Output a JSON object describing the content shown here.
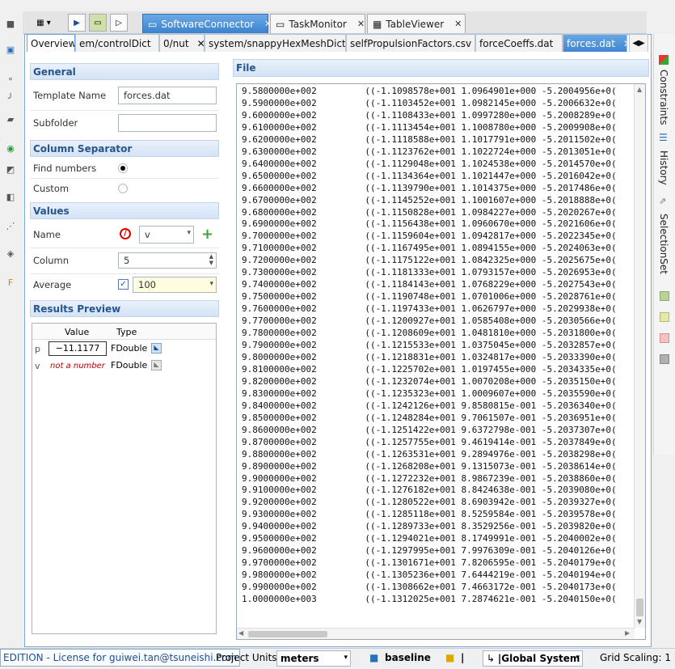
{
  "top_tabs": [
    {
      "label": "SoftwareConnector",
      "active": true
    },
    {
      "label": "TaskMonitor",
      "active": false
    },
    {
      "label": "TableViewer",
      "active": false
    }
  ],
  "doc_tabs": [
    {
      "label": "Overview",
      "state": "selected"
    },
    {
      "label": "em/controlDict",
      "state": "normal"
    },
    {
      "label": "0/nut",
      "state": "normal"
    },
    {
      "label": "system/snappyHexMeshDict",
      "state": "normal"
    },
    {
      "label": "selfPropulsionFactors.csv",
      "state": "normal"
    },
    {
      "label": "forceCoeffs.dat",
      "state": "normal"
    },
    {
      "label": "forces.dat",
      "state": "active"
    }
  ],
  "general": {
    "header": "General",
    "template_label": "Template Name",
    "template_value": "forces.dat",
    "subfolder_label": "Subfolder",
    "subfolder_value": ""
  },
  "column_separator": {
    "header": "Column Separator",
    "find_numbers_label": "Find numbers",
    "custom_label": "Custom",
    "selected": "find_numbers"
  },
  "values": {
    "header": "Values",
    "name_label": "Name",
    "name_value": "v",
    "column_label": "Column",
    "column_value": "5",
    "average_label": "Average",
    "average_checked": true,
    "average_value": "100"
  },
  "results_preview": {
    "header": "Results Preview",
    "col_value": "Value",
    "col_type": "Type",
    "rows": [
      {
        "name": "p",
        "value": "−11.1177",
        "type": "FDouble",
        "value_style": "normal"
      },
      {
        "name": "v",
        "value": "not a number",
        "type": "FDouble",
        "value_style": "error"
      }
    ]
  },
  "file": {
    "header": "File",
    "lines": [
      "9.5800000e+002         ((-1.1098578e+001 1.0964901e+000 -5.2004956e+0(",
      "9.5900000e+002         ((-1.1103452e+001 1.0982145e+000 -5.2006632e+0(",
      "9.6000000e+002         ((-1.1108433e+001 1.0997280e+000 -5.2008289e+0(",
      "9.6100000e+002         ((-1.1113454e+001 1.1008780e+000 -5.2009908e+0(",
      "9.6200000e+002         ((-1.1118588e+001 1.1017791e+000 -5.2011502e+0(",
      "9.6300000e+002         ((-1.1123762e+001 1.1022724e+000 -5.2013051e+0(",
      "9.6400000e+002         ((-1.1129048e+001 1.1024538e+000 -5.2014570e+0(",
      "9.6500000e+002         ((-1.1134364e+001 1.1021447e+000 -5.2016042e+0(",
      "9.6600000e+002         ((-1.1139790e+001 1.1014375e+000 -5.2017486e+0(",
      "9.6700000e+002         ((-1.1145252e+001 1.1001607e+000 -5.2018888e+0(",
      "9.6800000e+002         ((-1.1150828e+001 1.0984227e+000 -5.2020267e+0(",
      "9.6900000e+002         ((-1.1156438e+001 1.0960670e+000 -5.2021606e+0(",
      "9.7000000e+002         ((-1.1159604e+001 1.0942817e+000 -5.2022345e+0(",
      "9.7100000e+002         ((-1.1167495e+001 1.0894155e+000 -5.2024063e+0(",
      "9.7200000e+002         ((-1.1175122e+001 1.0842325e+000 -5.2025675e+0(",
      "9.7300000e+002         ((-1.1181333e+001 1.0793157e+000 -5.2026953e+0(",
      "9.7400000e+002         ((-1.1184143e+001 1.0768229e+000 -5.2027543e+0(",
      "9.7500000e+002         ((-1.1190748e+001 1.0701006e+000 -5.2028761e+0(",
      "9.7600000e+002         ((-1.1197433e+001 1.0626797e+000 -5.2029938e+0(",
      "9.7700000e+002         ((-1.1200927e+001 1.0585408e+000 -5.2030566e+0(",
      "9.7800000e+002         ((-1.1208609e+001 1.0481810e+000 -5.2031800e+0(",
      "9.7900000e+002         ((-1.1215533e+001 1.0375045e+000 -5.2032857e+0(",
      "9.8000000e+002         ((-1.1218831e+001 1.0324817e+000 -5.2033390e+0(",
      "9.8100000e+002         ((-1.1225702e+001 1.0197455e+000 -5.2034335e+0(",
      "9.8200000e+002         ((-1.1232074e+001 1.0070208e+000 -5.2035150e+0(",
      "9.8300000e+002         ((-1.1235323e+001 1.0009607e+000 -5.2035590e+0(",
      "9.8400000e+002         ((-1.1242126e+001 9.8580815e-001 -5.2036340e+0(",
      "9.8500000e+002         ((-1.1248284e+001 9.7061507e-001 -5.2036951e+0(",
      "9.8600000e+002         ((-1.1251422e+001 9.6372798e-001 -5.2037307e+0(",
      "9.8700000e+002         ((-1.1257755e+001 9.4619414e-001 -5.2037849e+0(",
      "9.8800000e+002         ((-1.1263531e+001 9.2894976e-001 -5.2038298e+0(",
      "9.8900000e+002         ((-1.1268208e+001 9.1315073e-001 -5.2038614e+0(",
      "9.9000000e+002         ((-1.1272232e+001 8.9867239e-001 -5.2038860e+0(",
      "9.9100000e+002         ((-1.1276182e+001 8.8424638e-001 -5.2039080e+0(",
      "9.9200000e+002         ((-1.1280522e+001 8.6903942e-001 -5.2039327e+0(",
      "9.9300000e+002         ((-1.1285118e+001 8.5259584e-001 -5.2039578e+0(",
      "9.9400000e+002         ((-1.1289733e+001 8.3529256e-001 -5.2039820e+0(",
      "9.9500000e+002         ((-1.1294021e+001 8.1749991e-001 -5.2040002e+0(",
      "9.9600000e+002         ((-1.1297995e+001 7.9976309e-001 -5.2040126e+0(",
      "9.9700000e+002         ((-1.1301671e+001 7.8206595e-001 -5.2040179e+0(",
      "9.9800000e+002         ((-1.1305236e+001 7.6444219e-001 -5.2040194e+0(",
      "9.9900000e+002         ((-1.1308662e+001 7.4663172e-001 -5.2040173e+0(",
      "1.0000000e+003         ((-1.1312025e+001 7.2874621e-001 -5.2040150e+0("
    ]
  },
  "right_tabs": [
    "Constraints",
    "History",
    "SelectionSet"
  ],
  "status": {
    "license": "EDITION - License for guiwei.tan@tsuneishi.com",
    "project_units_label": "Project Units:",
    "project_units_value": "meters",
    "baseline": "baseline",
    "folder_value": "|",
    "coord_system": "|Global System",
    "grid_scaling": "Grid Scaling: 1"
  },
  "colors": {
    "accent": "#3f86d1",
    "section_text": "#27548f",
    "error": "#c00000"
  }
}
